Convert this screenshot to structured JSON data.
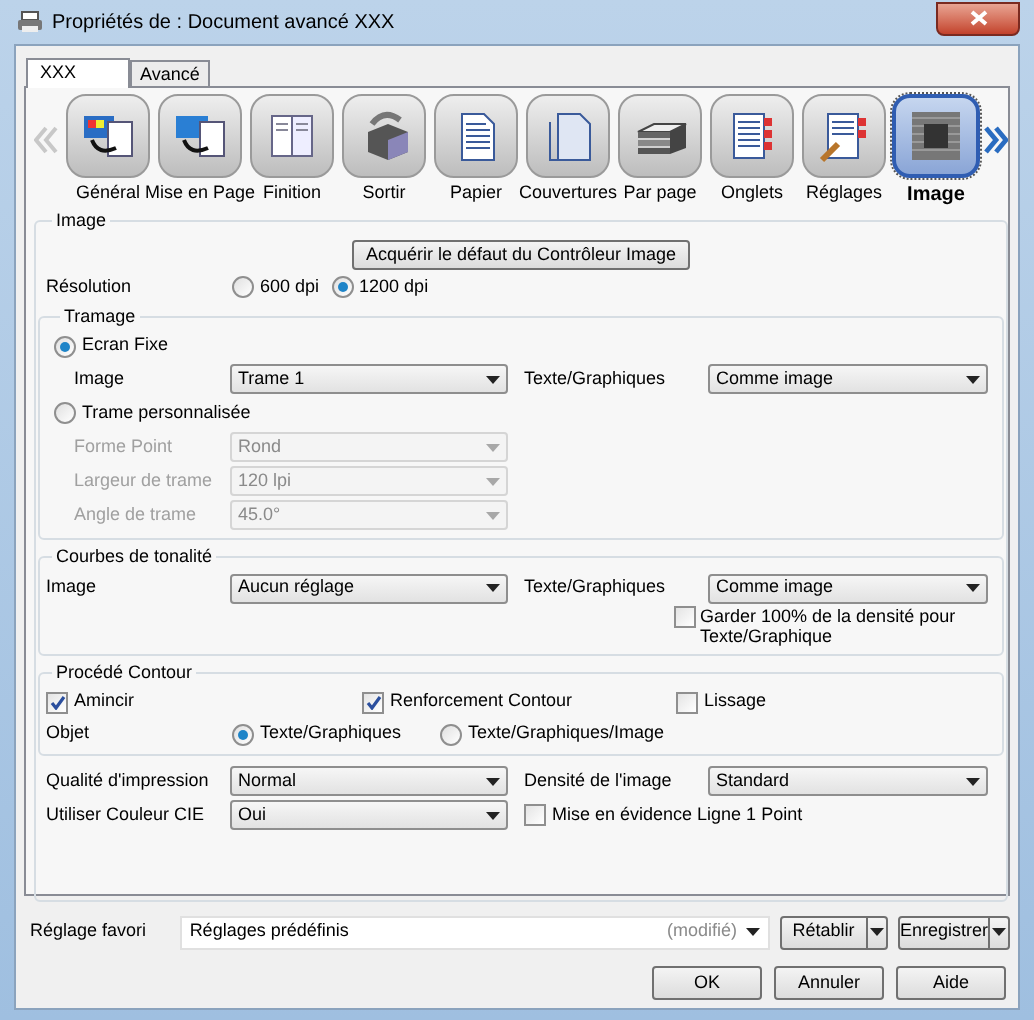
{
  "window": {
    "title": "Propriétés de : Document avancé XXX"
  },
  "tabs": [
    {
      "label": "XXX",
      "selected": true
    },
    {
      "label": "Avancé",
      "selected": false
    }
  ],
  "categories": [
    {
      "label": "Général",
      "selected": false
    },
    {
      "label": "Mise en Page",
      "selected": false
    },
    {
      "label": "Finition",
      "selected": false
    },
    {
      "label": "Sortir",
      "selected": false
    },
    {
      "label": "Papier",
      "selected": false
    },
    {
      "label": "Couvertures",
      "selected": false
    },
    {
      "label": "Par page",
      "selected": false
    },
    {
      "label": "Onglets",
      "selected": false
    },
    {
      "label": "Réglages",
      "selected": false
    },
    {
      "label": "Image",
      "selected": true
    }
  ],
  "image_section": {
    "title": "Image",
    "default_button": "Acquérir le défaut du Contrôleur Image",
    "resolution_label": "Résolution",
    "resolutions": [
      {
        "label": "600 dpi",
        "selected": false
      },
      {
        "label": "1200 dpi",
        "selected": true
      }
    ]
  },
  "tramage": {
    "title": "Tramage",
    "fixed": {
      "label": "Ecran Fixe",
      "selected": true,
      "image_label": "Image",
      "image_value": "Trame 1",
      "text_label": "Texte/Graphiques",
      "text_value": "Comme image"
    },
    "custom": {
      "label": "Trame personnalisée",
      "selected": false,
      "fields": [
        {
          "label": "Forme Point",
          "value": "Rond",
          "disabled": true
        },
        {
          "label": "Largeur de trame",
          "value": "120 lpi",
          "disabled": true
        },
        {
          "label": "Angle de trame",
          "value": "45.0°",
          "disabled": true
        }
      ]
    }
  },
  "courbes": {
    "title": "Courbes de tonalité",
    "image_label": "Image",
    "image_value": "Aucun réglage",
    "text_label": "Texte/Graphiques",
    "text_value": "Comme image",
    "keep_density": {
      "label": "Garder 100% de la densité pour Texte/Graphique",
      "checked": false
    }
  },
  "contour": {
    "title": "Procédé Contour",
    "options": [
      {
        "label": "Amincir",
        "checked": true
      },
      {
        "label": "Renforcement Contour",
        "checked": true
      },
      {
        "label": "Lissage",
        "checked": false
      }
    ],
    "object_label": "Objet",
    "objects": [
      {
        "label": "Texte/Graphiques",
        "selected": true
      },
      {
        "label": "Texte/Graphiques/Image",
        "selected": false
      }
    ]
  },
  "quality": {
    "label": "Qualité d'impression",
    "value": "Normal"
  },
  "density": {
    "label": "Densité de l'image",
    "value": "Standard"
  },
  "cie": {
    "label": "Utiliser Couleur CIE",
    "value": "Oui"
  },
  "highlight": {
    "label": "Mise en évidence Ligne 1 Point",
    "checked": false
  },
  "favorite": {
    "label": "Réglage favori",
    "value": "Réglages prédéfinis",
    "status": "(modifié)",
    "reset_button": "Rétablir",
    "save_button": "Enregistrer"
  },
  "buttons": [
    "OK",
    "Annuler",
    "Aide"
  ]
}
